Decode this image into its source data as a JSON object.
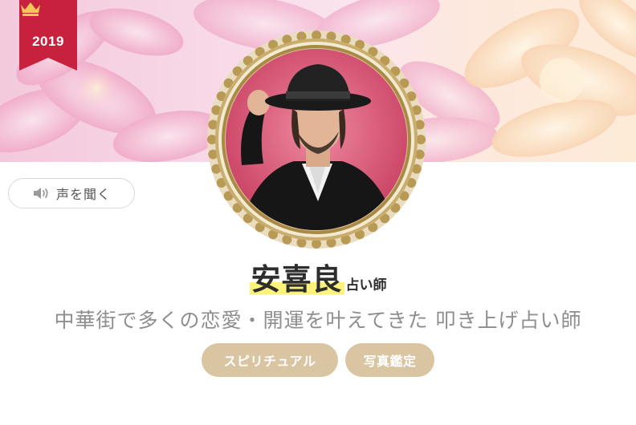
{
  "colors": {
    "ribbon": "#c8213e",
    "frame_gold": "#b89a55",
    "highlight": "#fdf27a",
    "tag_bg": "#d9c5a2",
    "avatar_bg": "#d9506e"
  },
  "ribbon": {
    "icon": "crown-icon",
    "year": "2019"
  },
  "voice_button": {
    "icon": "speaker-icon",
    "label": "声を聞く"
  },
  "avatar": {
    "icon": "avatar"
  },
  "profile": {
    "name": "安喜良",
    "role": "占い師",
    "catchphrase": "中華街で多くの恋愛・開運を叶えてきた 叩き上げ占い師",
    "tags": [
      {
        "label": "スピリチュアル"
      },
      {
        "label": "写真鑑定"
      }
    ]
  }
}
